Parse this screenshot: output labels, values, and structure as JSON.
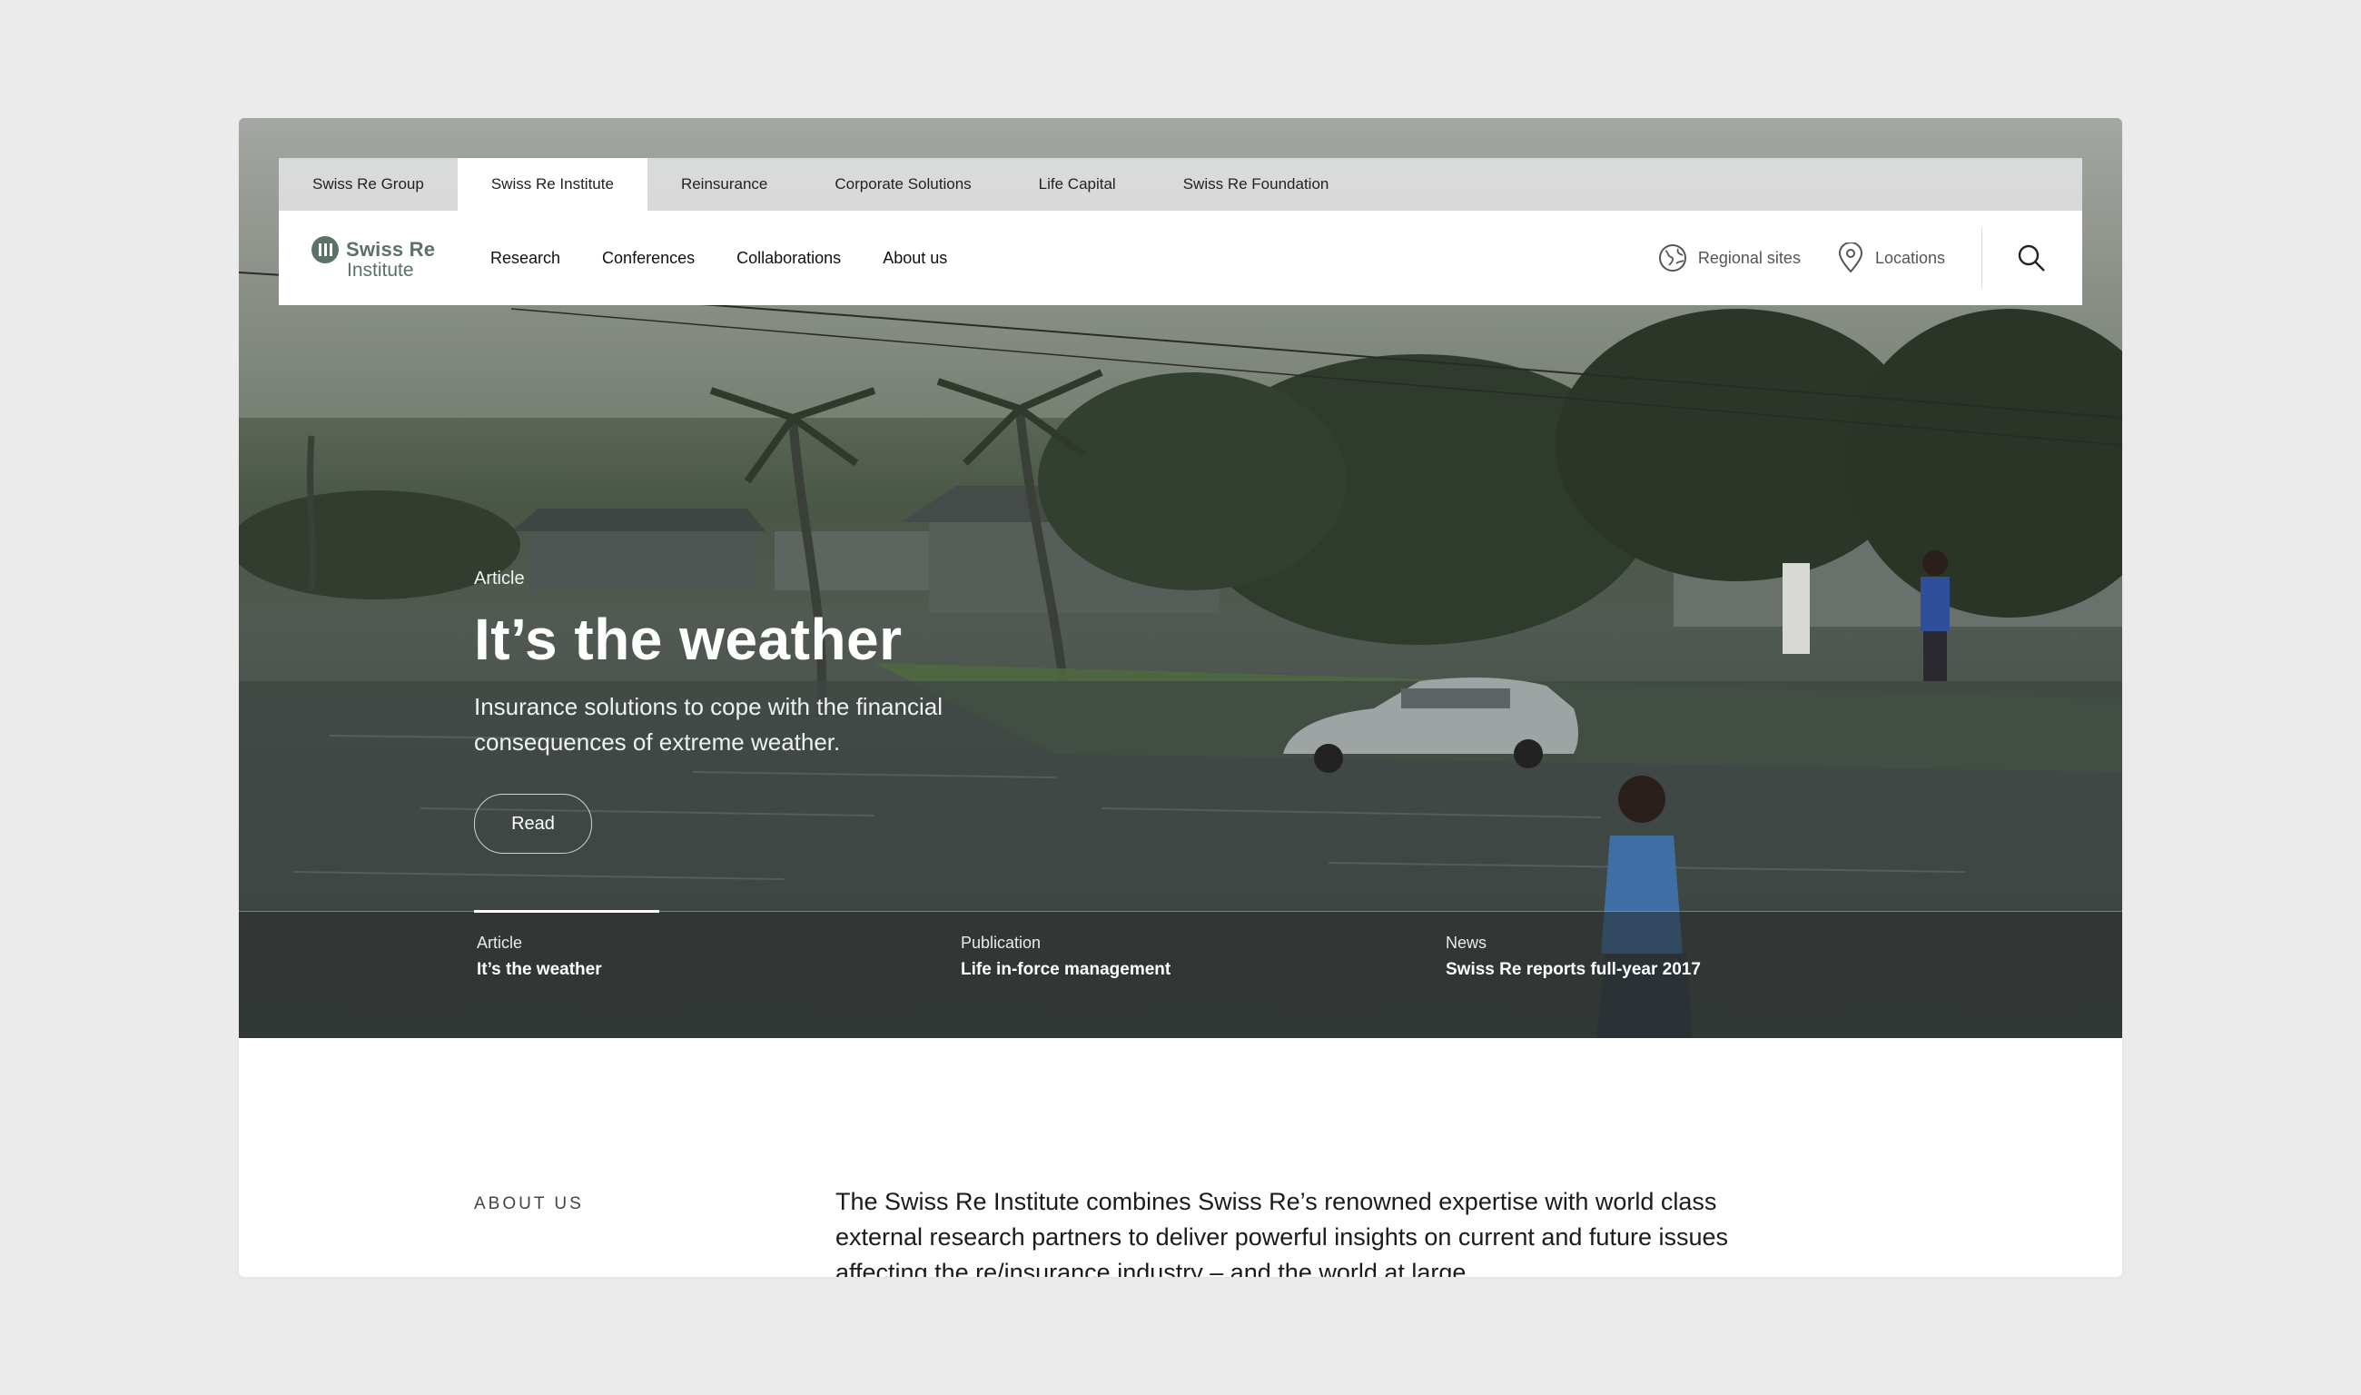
{
  "colors": {
    "page_bg": "#ebebeb",
    "brand": "#5b7266",
    "tab_active_bg": "#ffffff",
    "overlay_strip": "#2c302f"
  },
  "top_tabs": [
    {
      "label": "Swiss Re Group",
      "active": false
    },
    {
      "label": "Swiss Re Institute",
      "active": true
    },
    {
      "label": "Reinsurance",
      "active": false
    },
    {
      "label": "Corporate Solutions",
      "active": false
    },
    {
      "label": "Life Capital",
      "active": false
    },
    {
      "label": "Swiss Re Foundation",
      "active": false
    }
  ],
  "logo": {
    "line1": "Swiss Re",
    "line2": "Institute",
    "icon": "swiss-re-emblem"
  },
  "main_nav": [
    "Research",
    "Conferences",
    "Collaborations",
    "About us"
  ],
  "utilities": {
    "regional": {
      "label": "Regional sites",
      "icon": "globe-icon"
    },
    "locations": {
      "label": "Locations",
      "icon": "map-pin-icon"
    },
    "search": {
      "icon": "search-icon"
    }
  },
  "hero": {
    "kicker": "Article",
    "title": "It’s the weather",
    "subtitle_line1": "Insurance solutions to cope with the financial",
    "subtitle_line2": "consequences of extreme weather.",
    "cta": "Read"
  },
  "carousel": [
    {
      "type": "Article",
      "title": "It’s the weather",
      "active": true
    },
    {
      "type": "Publication",
      "title": "Life in-force management",
      "active": false
    },
    {
      "type": "News",
      "title": "Swiss Re reports full-year 2017",
      "active": false
    }
  ],
  "about": {
    "label": "ABOUT US",
    "text": "The Swiss Re Institute combines Swiss Re’s renowned expertise with world class external research partners to deliver powerful insights on current and future issues affecting the re/insurance industry – and the world at large."
  }
}
